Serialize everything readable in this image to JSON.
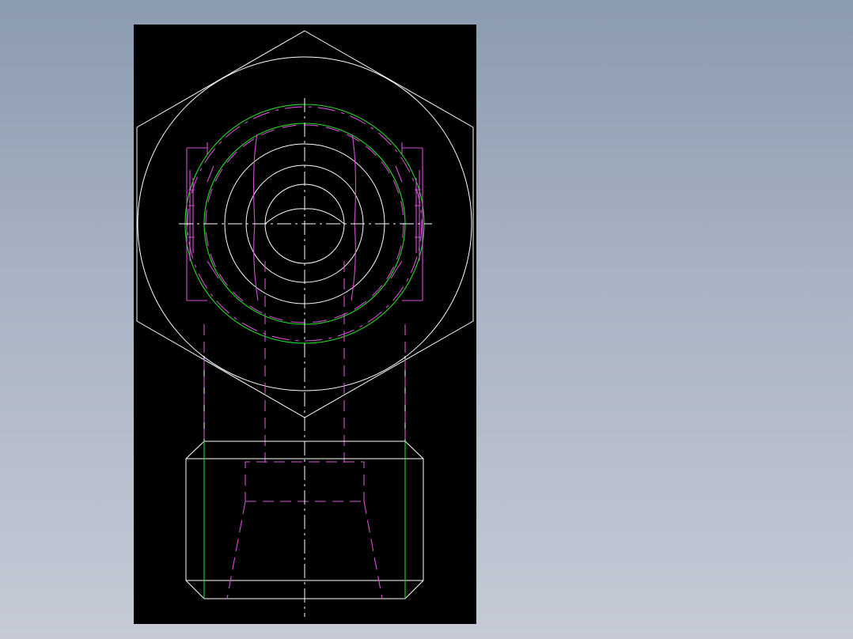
{
  "drawing": {
    "background": "#000000",
    "colors": {
      "outline": "#ffffff",
      "thread": "#22dd22",
      "hidden": "#d64fd6",
      "centerline": "#ffffff"
    }
  }
}
